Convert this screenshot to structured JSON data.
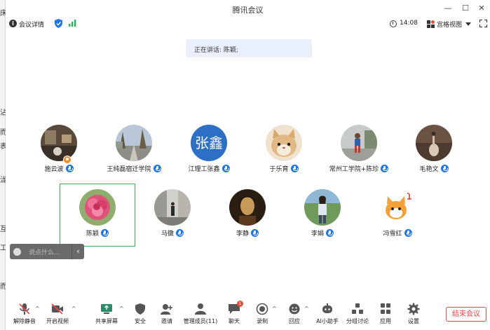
{
  "window": {
    "title": "腾讯会议"
  },
  "info_bar": {
    "meeting_details": "会议详情",
    "time": "14:08",
    "view_mode": "宫格视图"
  },
  "speaking": {
    "text": "正在讲话: 陈颖;"
  },
  "participants_row1": [
    {
      "name": "施云波",
      "host": true,
      "avatar": "photo-room"
    },
    {
      "name": "王纯磊宿迁学院",
      "avatar": "photo-road"
    },
    {
      "name": "江理工张鑫",
      "avatar": "initials",
      "initials": "张鑫"
    },
    {
      "name": "于乐育",
      "avatar": "photo-cat"
    },
    {
      "name": "常州工学院+陈珍",
      "avatar": "photo-child"
    },
    {
      "name": "毛艳文",
      "avatar": "photo-goose"
    }
  ],
  "participants_row2": [
    {
      "name": "陈颖",
      "avatar": "photo-flower",
      "selected": true
    },
    {
      "name": "马黴",
      "avatar": "photo-street"
    },
    {
      "name": "李静",
      "avatar": "photo-portrait"
    },
    {
      "name": "李娟",
      "avatar": "photo-woman"
    },
    {
      "name": "冯雪红",
      "avatar": "cartoon-cat"
    }
  ],
  "chat": {
    "placeholder": "说点什么..."
  },
  "toolbar": {
    "unmute": "解除静音",
    "start_video": "开启视频",
    "share_screen": "共享屏幕",
    "security": "安全",
    "invite": "邀请",
    "manage_members": "管理成员(11)",
    "chat": "聊天",
    "chat_badge": "1",
    "record": "录制",
    "reaction": "回应",
    "ai_assistant": "AI小助手",
    "breakout": "分组讨论",
    "apps": "应用",
    "settings": "设置",
    "end_meeting": "结束会议"
  },
  "colors": {
    "accent": "#1e74e8",
    "end": "#e64848",
    "selected": "#2fb35a"
  },
  "background_window": {
    "edge_chars": [
      "床",
      "沾",
      "而",
      "表",
      "泷",
      "互",
      "工",
      "而"
    ]
  }
}
